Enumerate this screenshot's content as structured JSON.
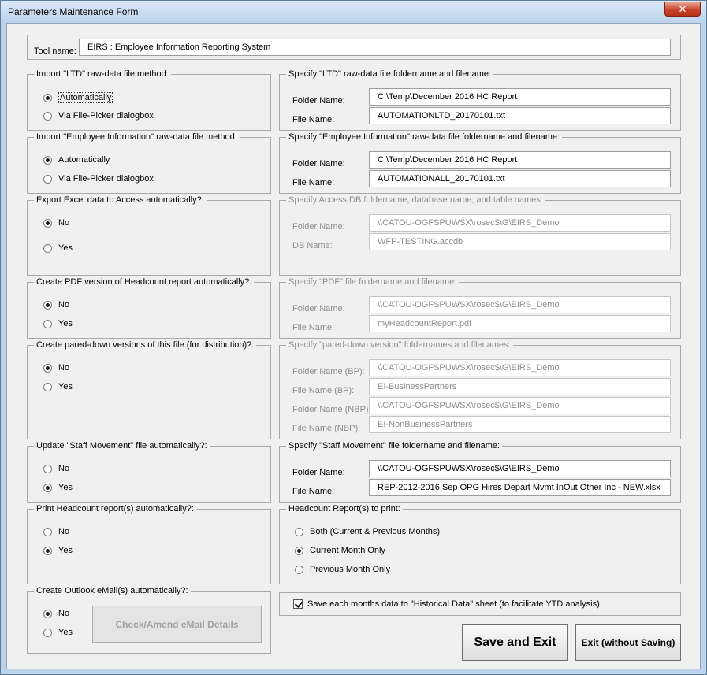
{
  "window": {
    "title": "Parameters Maintenance Form",
    "close_glyph": "✕"
  },
  "tool": {
    "label": "Tool name:",
    "value": "EIRS : Employee Information Reporting System"
  },
  "ltd_method": {
    "legend": "Import \"LTD\" raw-data file method:",
    "options": [
      "Automatically",
      "Via File-Picker dialogbox"
    ],
    "selected": 0
  },
  "ltd_file": {
    "legend": "Specify \"LTD\" raw-data file foldername and filename:",
    "folder_label": "Folder Name:",
    "folder": "C:\\Temp\\December 2016 HC Report",
    "file_label": "File Name:",
    "file": "AUTOMATIONLTD_20170101.txt"
  },
  "emp_method": {
    "legend": "Import \"Employee Information\" raw-data file method:",
    "options": [
      "Automatically",
      "Via File-Picker dialogbox"
    ],
    "selected": 0
  },
  "emp_file": {
    "legend": "Specify \"Employee Information\" raw-data file foldername and filename:",
    "folder_label": "Folder Name:",
    "folder": "C:\\Temp\\December 2016 HC Report",
    "file_label": "File Name:",
    "file": "AUTOMATIONALL_20170101.txt"
  },
  "access_export": {
    "legend": "Export Excel data to Access automatically?:",
    "options": [
      "No",
      "Yes"
    ],
    "selected": 0
  },
  "access_file": {
    "legend": "Specify Access DB foldername, database name, and table names:",
    "folder_label": "Folder Name:",
    "folder": "\\\\CATOU-OGFSPUWSX\\rosec$\\G\\EIRS_Demo",
    "db_label": "DB Name:",
    "db": "WFP-TESTING.accdb"
  },
  "pdf_create": {
    "legend": "Create PDF version of Headcount report automatically?:",
    "options": [
      "No",
      "Yes"
    ],
    "selected": 0
  },
  "pdf_file": {
    "legend": "Specify \"PDF\" file foldername and filename:",
    "folder_label": "Folder Name:",
    "folder": "\\\\CATOU-OGFSPUWSX\\rosec$\\G\\EIRS_Demo",
    "file_label": "File Name:",
    "file": "myHeadcountReport.pdf"
  },
  "pared_create": {
    "legend": "Create pared-down versions of this file (for distribution)?:",
    "options": [
      "No",
      "Yes"
    ],
    "selected": 0
  },
  "pared_file": {
    "legend": "Specify \"pared-down version\" foldernames and filenames:",
    "folder_bp_label": "Folder Name (BP):",
    "folder_bp": "\\\\CATOU-OGFSPUWSX\\rosec$\\G\\EIRS_Demo",
    "file_bp_label": "File Name (BP):",
    "file_bp": "EI-BusinessPartners",
    "folder_nbp_label": "Folder Name (NBP):",
    "folder_nbp": "\\\\CATOU-OGFSPUWSX\\rosec$\\G\\EIRS_Demo",
    "file_nbp_label": "File Name (NBP):",
    "file_nbp": "EI-NonBusinessPartners"
  },
  "staff_update": {
    "legend": "Update \"Staff Movement\" file automatically?:",
    "options": [
      "No",
      "Yes"
    ],
    "selected": 1
  },
  "staff_file": {
    "legend": "Specify \"Staff Movement\" file foldername and filename:",
    "folder_label": "Folder Name:",
    "folder": "\\\\CATOU-OGFSPUWSX\\rosec$\\G\\EIRS_Demo",
    "file_label": "File Name:",
    "file": "REP-2012-2016 Sep OPG Hires Depart Mvmt InOut Other Inc - NEW.xlsx"
  },
  "print_auto": {
    "legend": "Print Headcount report(s) automatically?:",
    "options": [
      "No",
      "Yes"
    ],
    "selected": 1
  },
  "print_which": {
    "legend": "Headcount Report(s) to print:",
    "options": [
      "Both (Current & Previous Months)",
      "Current Month Only",
      "Previous Month Only"
    ],
    "selected": 1
  },
  "email_auto": {
    "legend": "Create Outlook eMail(s) automatically?:",
    "options": [
      "No",
      "Yes"
    ],
    "selected": 0,
    "details_button": "Check/Amend eMail Details"
  },
  "history": {
    "label": "Save each months data to \"Historical Data\" sheet (to facilitate YTD analysis)",
    "checked": true
  },
  "actions": {
    "save_hot": "S",
    "save_rest": "ave and Exit",
    "exit_hot": "E",
    "exit_rest": "xit (without Saving)"
  }
}
